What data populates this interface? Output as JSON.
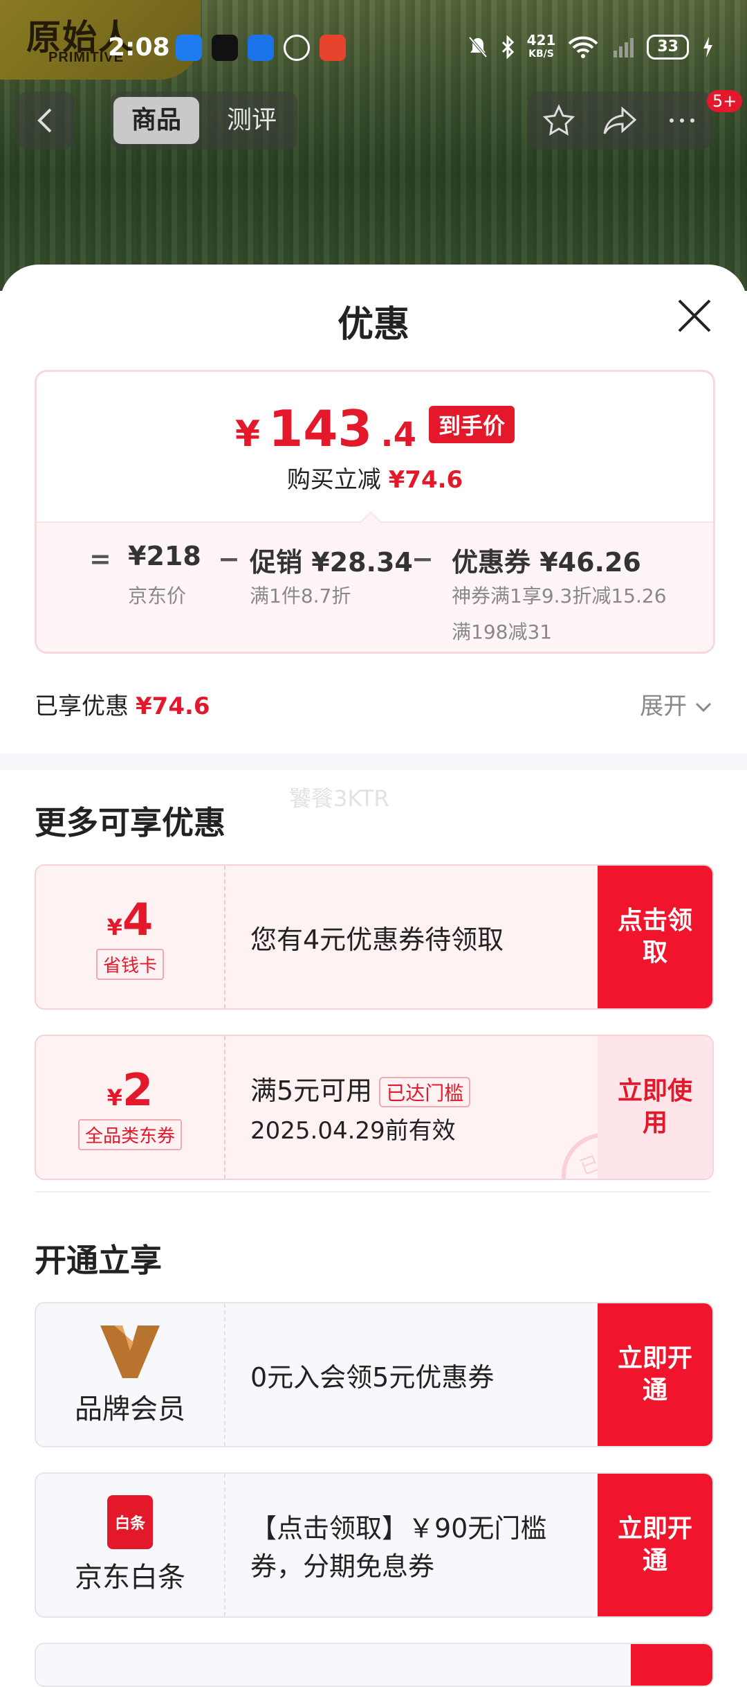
{
  "status_bar": {
    "brand_logo_cn": "原始人",
    "brand_logo_en": "PRIMITIVE",
    "time": "2:08",
    "net_speed": "421",
    "net_unit": "KB/S",
    "battery": "33"
  },
  "nav": {
    "tabs": [
      "商品",
      "测评"
    ],
    "active_tab": "商品",
    "badge": "5+"
  },
  "sheet": {
    "title": "优惠",
    "price": {
      "yen": "¥",
      "value": "143",
      "decimal": ".4",
      "tag": "到手价",
      "cut_label": "购买立减",
      "cut_value": "¥74.6"
    },
    "breakdown": {
      "eq": "=",
      "minus": "−",
      "jd_price": "¥218",
      "jd_label": "京东价",
      "promo_title": "促销 ¥28.34",
      "promo_sub": "满1件8.7折",
      "coupon_title": "优惠券 ¥46.26",
      "coupon_sub1": "神券满1享9.3折减15.26",
      "coupon_sub2": "满198减31"
    },
    "enjoyed_label": "已享优惠",
    "enjoyed_value": "¥74.6",
    "expand": "展开",
    "watermark": "饕餮3KTR",
    "more_title": "更多可享优惠",
    "coupons": [
      {
        "yen": "¥",
        "amount": "4",
        "label": "省钱卡",
        "desc": "您有4元优惠券待领取",
        "action": "点击领取"
      },
      {
        "yen": "¥",
        "amount": "2",
        "label": "全品类东券",
        "desc": "满5元可用",
        "reached": "已达门槛",
        "valid": "2025.04.29前有效",
        "action": "立即使用",
        "stamp": "已领"
      }
    ],
    "open_title": "开通立享",
    "memberships": [
      {
        "name": "品牌会员",
        "desc": "0元入会领5元优惠券",
        "action": "立即开通"
      },
      {
        "name": "京东白条",
        "icon_text": "白条",
        "desc1": "【点击领取】￥90无门槛",
        "desc2": "券，分期免息券",
        "action": "立即开通"
      }
    ]
  },
  "colors": {
    "accent": "#e3192b",
    "action_red": "#f0142c"
  }
}
